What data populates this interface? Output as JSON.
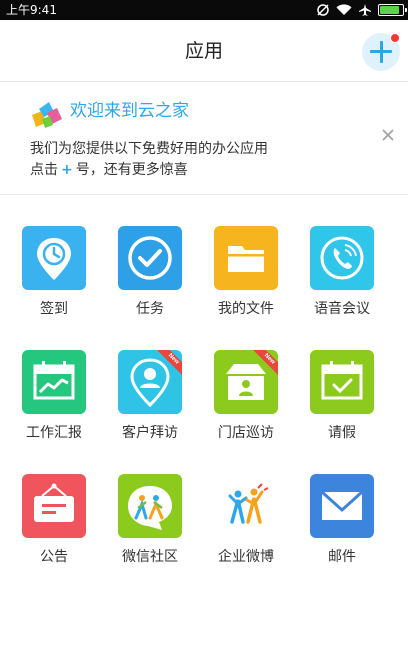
{
  "status_bar": {
    "time": "上午9:41",
    "battery_level": 0.9
  },
  "header": {
    "title": "应用"
  },
  "banner": {
    "title": "欢迎来到云之家",
    "line1": "我们为您提供以下免费好用的办公应用",
    "line2_prefix": "点击",
    "line2_plus": "+",
    "line2_suffix": "号，还有更多惊喜"
  },
  "apps": [
    {
      "label": "签到",
      "icon": "location-clock-icon",
      "color": "#3ab2ef"
    },
    {
      "label": "任务",
      "icon": "check-circle-icon",
      "color": "#2ea0e8"
    },
    {
      "label": "我的文件",
      "icon": "folder-icon",
      "color": "#f6b51e"
    },
    {
      "label": "语音会议",
      "icon": "phone-icon",
      "color": "#2fc6e9"
    },
    {
      "label": "工作汇报",
      "icon": "chart-calendar-icon",
      "color": "#25c77e"
    },
    {
      "label": "客户拜访",
      "icon": "person-pin-icon",
      "color": "#2fc4e6",
      "badge": "New"
    },
    {
      "label": "门店巡访",
      "icon": "store-icon",
      "color": "#8ccb1e",
      "badge": "New"
    },
    {
      "label": "请假",
      "icon": "calendar-check-icon",
      "color": "#8ccb1e"
    },
    {
      "label": "公告",
      "icon": "notice-board-icon",
      "color": "#f0555e"
    },
    {
      "label": "微信社区",
      "icon": "wechat-community-icon",
      "color": "#8ccb1e"
    },
    {
      "label": "企业微博",
      "icon": "people-cheer-icon",
      "color": "#ffffff"
    },
    {
      "label": "邮件",
      "icon": "mail-icon",
      "color": "#3d84dc"
    }
  ]
}
